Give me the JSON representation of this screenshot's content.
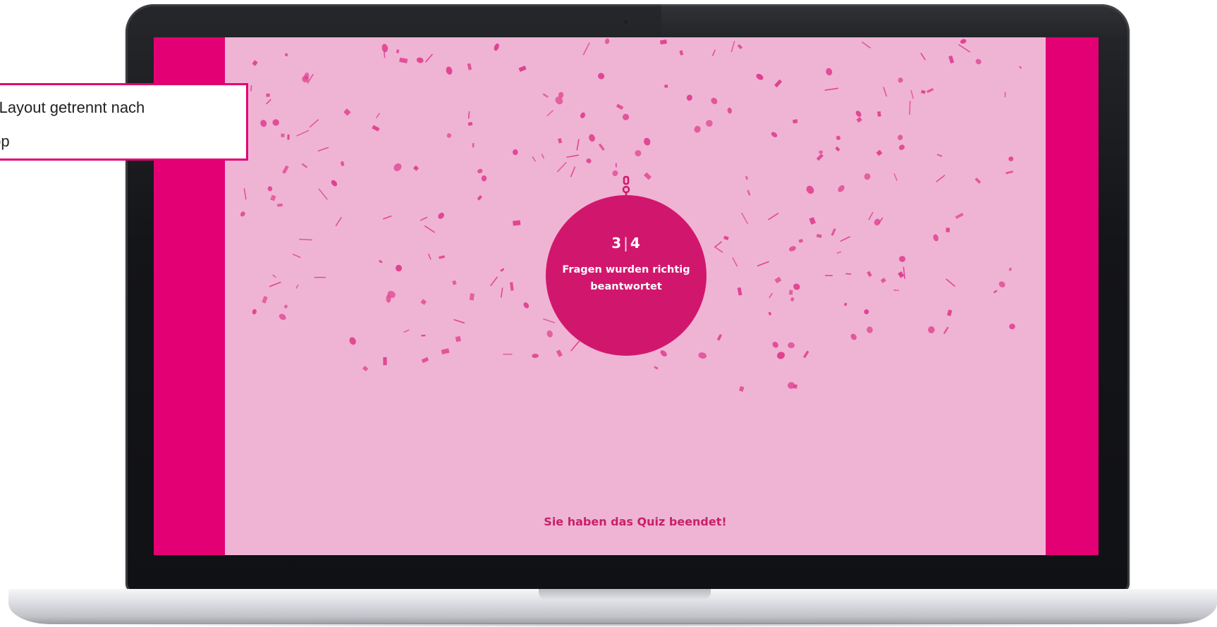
{
  "quiz": {
    "score_correct": "3",
    "score_separator": "|",
    "score_total": "4",
    "result_text": "Fragen wurden richtig beantwortet",
    "finished_message": "Sie haben das Quiz beendet!"
  },
  "callout": {
    "line1": "nes Layout getrennt nach",
    "line2": "sktop"
  },
  "colors": {
    "brand_magenta": "#e20074",
    "quiz_background": "#efb4d4",
    "medal": "#d1176d",
    "confetti": "#e0408f"
  },
  "icons": {
    "medal": "medal-icon",
    "confetti": "confetti-decoration"
  }
}
